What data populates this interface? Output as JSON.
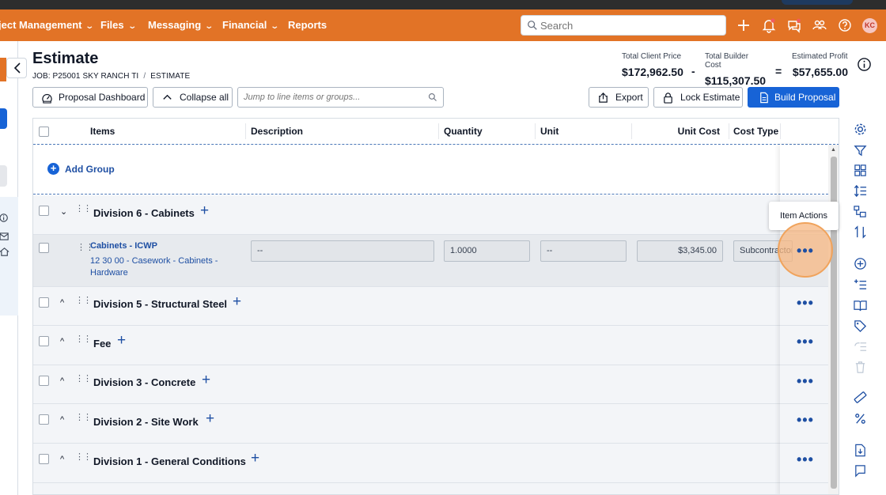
{
  "nav": {
    "items": [
      {
        "label": "ject Management",
        "has_chevron": true
      },
      {
        "label": "Files",
        "has_chevron": true
      },
      {
        "label": "Messaging",
        "has_chevron": true
      },
      {
        "label": "Financial",
        "has_chevron": true
      },
      {
        "label": "Reports",
        "has_chevron": false
      }
    ],
    "search_placeholder": "Search",
    "user_initials": "KC",
    "icons": [
      "plus-icon",
      "bell-icon",
      "chat-icon",
      "people-icon",
      "help-icon"
    ]
  },
  "page": {
    "title": "Estimate",
    "breadcrumb": {
      "job": "JOB: P25001 SKY RANCH TI",
      "separator": "/",
      "current": "ESTIMATE"
    }
  },
  "totals": {
    "client_price_label": "Total Client Price",
    "client_price": "$172,962.50",
    "builder_cost_label": "Total Builder Cost",
    "builder_cost": "$115,307.50",
    "profit_label": "Estimated Profit",
    "profit": "$57,655.00",
    "minus": "-",
    "equals": "="
  },
  "toolbar": {
    "proposal_dashboard": "Proposal Dashboard",
    "collapse_all": "Collapse all",
    "jump_placeholder": "Jump to line items or groups...",
    "export": "Export",
    "lock_estimate": "Lock Estimate",
    "build_proposal": "Build Proposal"
  },
  "table": {
    "headers": {
      "items": "Items",
      "description": "Description",
      "quantity": "Quantity",
      "unit": "Unit",
      "unit_cost": "Unit Cost",
      "cost_type": "Cost Type"
    },
    "add_group": "Add Group",
    "groups": [
      {
        "name": "Division 6 - Cabinets",
        "expanded": true
      },
      {
        "name": "Division 5 - Structural Steel",
        "expanded": false
      },
      {
        "name": "Fee",
        "expanded": false
      },
      {
        "name": "Division 3 - Concrete",
        "expanded": false
      },
      {
        "name": "Division 2 - Site Work",
        "expanded": false
      },
      {
        "name": "Division 1 - General Conditions",
        "expanded": false
      }
    ],
    "item": {
      "name": "Cabinets - ICWP",
      "code": "12 30 00 - Casework - Cabinets - Hardware",
      "description": "--",
      "quantity": "1.0000",
      "unit": "--",
      "unit_cost": "$3,345.00",
      "cost_type": "Subcontractor"
    },
    "tooltip": "Item Actions",
    "more_glyph": "•••"
  },
  "colors": {
    "brand_orange": "#e27326",
    "primary_blue": "#1763d6",
    "link_blue": "#1e4fa3"
  }
}
